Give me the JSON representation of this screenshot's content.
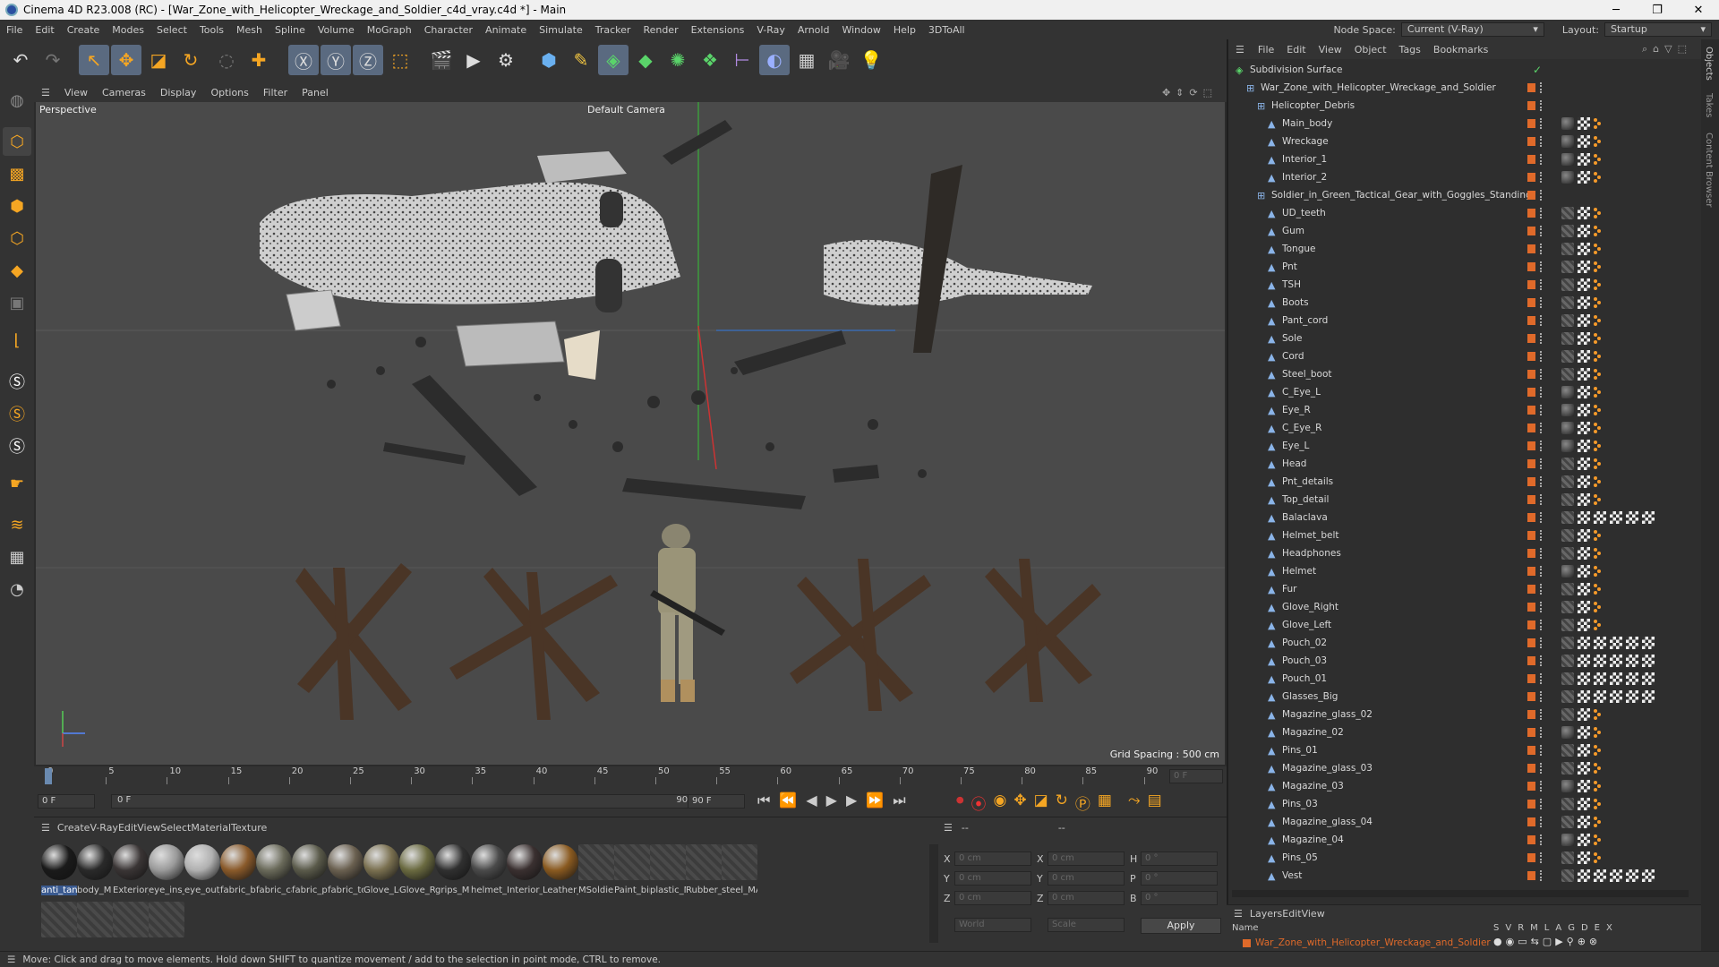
{
  "window": {
    "title": "Cinema 4D R23.008 (RC) - [War_Zone_with_Helicopter_Wreckage_and_Soldier_c4d_vray.c4d *] - Main",
    "minimize": "─",
    "maximize": "❐",
    "close": "✕"
  },
  "menu": [
    "File",
    "Edit",
    "Create",
    "Modes",
    "Select",
    "Tools",
    "Mesh",
    "Spline",
    "Volume",
    "MoGraph",
    "Character",
    "Animate",
    "Simulate",
    "Tracker",
    "Render",
    "Extensions",
    "V-Ray",
    "Arnold",
    "Window",
    "Help",
    "3DToAll"
  ],
  "nodespace": {
    "label": "Node Space:",
    "value": "Current (V-Ray)"
  },
  "layout": {
    "label": "Layout:",
    "value": "Startup"
  },
  "viewport": {
    "menu": [
      "View",
      "Cameras",
      "Display",
      "Options",
      "Filter",
      "Panel"
    ],
    "name": "Perspective",
    "camera": "Default Camera",
    "grid": "Grid Spacing : 500 cm"
  },
  "timeline": {
    "ticks": [
      "0",
      "5",
      "10",
      "15",
      "20",
      "25",
      "30",
      "35",
      "40",
      "45",
      "50",
      "55",
      "60",
      "65",
      "70",
      "75",
      "80",
      "85",
      "90"
    ],
    "frame_end": "0 F"
  },
  "transport": {
    "start": "0 F",
    "current": "0 F",
    "end": "90 F",
    "end2": "90 F"
  },
  "materials": {
    "menu": [
      "Create",
      "V-Ray",
      "Edit",
      "View",
      "Select",
      "Material",
      "Texture"
    ],
    "items": [
      "anti_tank",
      "body_M",
      "Exterior_",
      "eye_ins_l",
      "eye_out_",
      "fabric_bc",
      "fabric_ca",
      "fabric_pr",
      "fabric_to",
      "Glove_Le",
      "Glove_Ri",
      "grips_M",
      "helmet_c",
      "Interior_",
      "Leather_",
      "MSoldie",
      "Paint_bir",
      "plastic_M",
      "Rubber_",
      "steel_MA"
    ]
  },
  "coords": {
    "header": "--",
    "header2": "--",
    "x": "0 cm",
    "y": "0 cm",
    "z": "0 cm",
    "x2": "0 cm",
    "y2": "0 cm",
    "z2": "0 cm",
    "h": "0 °",
    "p": "0 °",
    "b": "0 °",
    "lx": "X",
    "ly": "Y",
    "lz": "Z",
    "lx2": "X",
    "ly2": "Y",
    "lz2": "Z",
    "lh": "H",
    "lp": "P",
    "lb": "B",
    "world": "World",
    "scale": "Scale",
    "apply": "Apply"
  },
  "objects": {
    "menu": [
      "File",
      "Edit",
      "View",
      "Object",
      "Tags",
      "Bookmarks"
    ],
    "rows": [
      {
        "name": "Subdivision Surface",
        "level": 0
      },
      {
        "name": "War_Zone_with_Helicopter_Wreckage_and_Soldier",
        "level": 1
      },
      {
        "name": "Helicopter_Debris",
        "level": 2
      },
      {
        "name": "Main_body",
        "level": 3
      },
      {
        "name": "Wreckage",
        "level": 3
      },
      {
        "name": "Interior_1",
        "level": 3
      },
      {
        "name": "Interior_2",
        "level": 3
      },
      {
        "name": "Soldier_in_Green_Tactical_Gear_with_Goggles_Standing",
        "level": 2
      },
      {
        "name": "UD_teeth",
        "level": 3
      },
      {
        "name": "Gum",
        "level": 3
      },
      {
        "name": "Tongue",
        "level": 3
      },
      {
        "name": "Pnt",
        "level": 3
      },
      {
        "name": "TSH",
        "level": 3
      },
      {
        "name": "Boots",
        "level": 3
      },
      {
        "name": "Pant_cord",
        "level": 3
      },
      {
        "name": "Sole",
        "level": 3
      },
      {
        "name": "Cord",
        "level": 3
      },
      {
        "name": "Steel_boot",
        "level": 3
      },
      {
        "name": "C_Eye_L",
        "level": 3
      },
      {
        "name": "Eye_R",
        "level": 3
      },
      {
        "name": "C_Eye_R",
        "level": 3
      },
      {
        "name": "Eye_L",
        "level": 3
      },
      {
        "name": "Head",
        "level": 3
      },
      {
        "name": "Pnt_details",
        "level": 3
      },
      {
        "name": "Top_detail",
        "level": 3
      },
      {
        "name": "Balaclava",
        "level": 3
      },
      {
        "name": "Helmet_belt",
        "level": 3
      },
      {
        "name": "Headphones",
        "level": 3
      },
      {
        "name": "Helmet",
        "level": 3
      },
      {
        "name": "Fur",
        "level": 3
      },
      {
        "name": "Glove_Right",
        "level": 3
      },
      {
        "name": "Glove_Left",
        "level": 3
      },
      {
        "name": "Pouch_02",
        "level": 3
      },
      {
        "name": "Pouch_03",
        "level": 3
      },
      {
        "name": "Pouch_01",
        "level": 3
      },
      {
        "name": "Glasses_Big",
        "level": 3
      },
      {
        "name": "Magazine_glass_02",
        "level": 3
      },
      {
        "name": "Magazine_02",
        "level": 3
      },
      {
        "name": "Pins_01",
        "level": 3
      },
      {
        "name": "Magazine_glass_03",
        "level": 3
      },
      {
        "name": "Magazine_03",
        "level": 3
      },
      {
        "name": "Pins_03",
        "level": 3
      },
      {
        "name": "Magazine_glass_04",
        "level": 3
      },
      {
        "name": "Magazine_04",
        "level": 3
      },
      {
        "name": "Pins_05",
        "level": 3
      },
      {
        "name": "Vest",
        "level": 3
      }
    ]
  },
  "layers": {
    "menu": [
      "Layers",
      "Edit",
      "View"
    ],
    "col_name": "Name",
    "cols": [
      "S",
      "V",
      "R",
      "M",
      "L",
      "A",
      "G",
      "D",
      "E",
      "X"
    ],
    "row": "War_Zone_with_Helicopter_Wreckage_and_Soldier"
  },
  "status": "Move: Click and drag to move elements. Hold down SHIFT to quantize movement / add to the selection in point mode, CTRL to remove.",
  "sidetabs": [
    "Objects",
    "Takes",
    "Content Browser"
  ],
  "colors": {
    "accent": "#e06a2a",
    "active": "#5a6a80"
  }
}
